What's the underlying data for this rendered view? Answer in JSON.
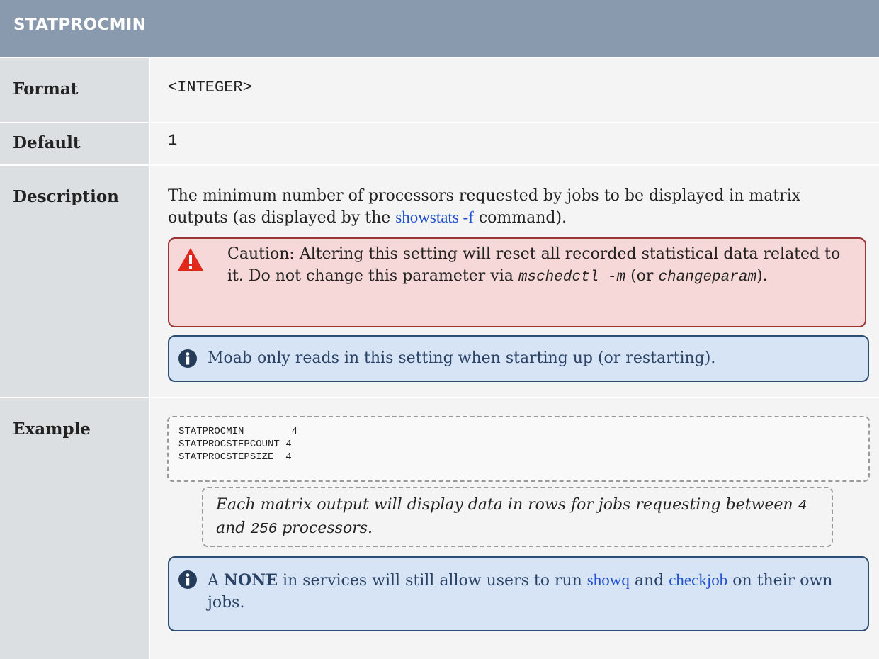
{
  "title": "STATPROCMIN",
  "rows": {
    "format": {
      "label": "Format",
      "value": "<INTEGER>"
    },
    "default": {
      "label": "Default",
      "value": "1"
    },
    "description": {
      "label": "Description",
      "text_before": "The minimum number of processors requested by jobs to be displayed in matrix outputs (as displayed by the ",
      "link": "showstats -f",
      "text_after": " command).",
      "caution": {
        "prefix": "Caution: Altering this setting will reset all recorded statistical data related to it. Do not change this parameter via ",
        "cmd1": "mschedctl -m",
        "mid": " (or ",
        "cmd2": "changeparam",
        "suffix": ")."
      },
      "note": "Moab only reads in this setting when starting up (or restarting)."
    },
    "example": {
      "label": "Example",
      "code": [
        "STATPROCMIN        4",
        "STATPROCSTEPCOUNT 4",
        "STATPROCSTEPSIZE  4"
      ],
      "explanation": {
        "part1": "Each matrix output will display data in rows for jobs requesting between ",
        "num1": "4",
        "part2": " and ",
        "num2": "256",
        "part3": " processors."
      },
      "note": {
        "prefix": "A ",
        "bold": "NONE",
        "mid1": " in services will still allow users to run ",
        "link1": "showq",
        "mid2": " and ",
        "link2": "checkjob",
        "suffix": " on their own jobs."
      }
    }
  },
  "colors": {
    "header": "#8a9aae",
    "label_bg": "#dcdfe2",
    "value_bg": "#f4f4f4",
    "caution_bg": "#f7d8d8",
    "note_bg": "#d6e4f5",
    "link": "#1f4fd1"
  },
  "icons": {
    "caution": "warning-triangle-icon",
    "note": "info-circle-icon"
  }
}
